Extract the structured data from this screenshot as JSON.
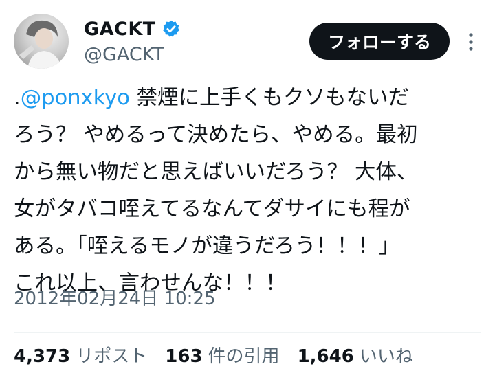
{
  "author": {
    "display_name": "GACKT",
    "handle": "@GACKT",
    "verified": true
  },
  "follow_button": "フォローする",
  "tweet": {
    "prefix": ".",
    "mention": "@ponxkyo",
    "body": " 禁煙に上手くもクソもないだ\nろう？ やめるって決めたら、やめる。最初\nから無い物だと思えばいいだろう？ 大体、\n女がタバコ咥えてるなんてダサイにも程が\nある。「咥えるモノが違うだろう！！！」\nこれ以上、言わせんな！！！",
    "timestamp": "2012年02月24日 10:25"
  },
  "stats": {
    "reposts_count": "4,373",
    "reposts_label": "リポスト",
    "quotes_count": "163",
    "quotes_label": "件の引用",
    "likes_count": "1,646",
    "likes_label": "いいね"
  },
  "colors": {
    "accent": "#1d9bf0",
    "text": "#0f1419",
    "muted": "#536471",
    "button_bg": "#0f1419"
  }
}
